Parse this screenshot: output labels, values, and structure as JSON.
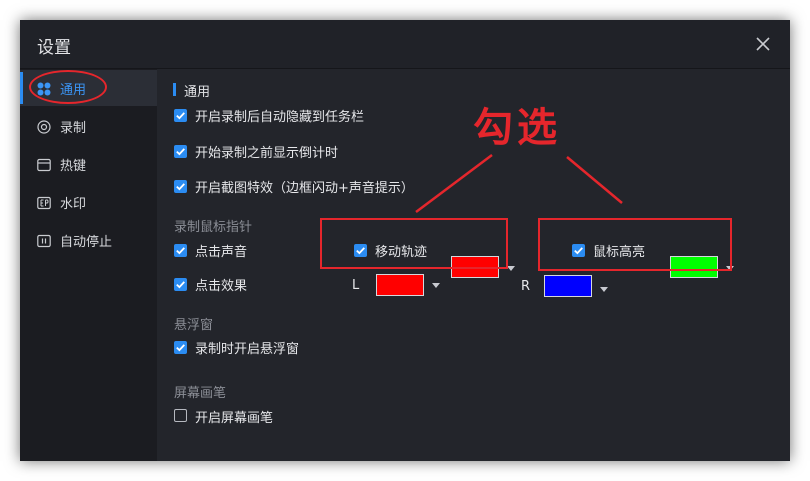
{
  "window": {
    "title": "设置"
  },
  "sidebar": {
    "items": [
      {
        "label": "通用",
        "icon": "grid-icon",
        "active": true
      },
      {
        "label": "录制",
        "icon": "record-icon",
        "active": false
      },
      {
        "label": "热键",
        "icon": "hotkey-icon",
        "active": false
      },
      {
        "label": "水印",
        "icon": "watermark-icon",
        "active": false
      },
      {
        "label": "自动停止",
        "icon": "pause-icon",
        "active": false
      }
    ]
  },
  "general": {
    "section_title": "通用",
    "options": [
      {
        "label": "开启录制后自动隐藏到任务栏",
        "checked": true
      },
      {
        "label": "开始录制之前显示倒计时",
        "checked": true
      },
      {
        "label": "开启截图特效（边框闪动+声音提示）",
        "checked": true
      }
    ]
  },
  "mouse": {
    "group_title": "录制鼠标指针",
    "click_sound": {
      "label": "点击声音",
      "checked": true
    },
    "move_track": {
      "label": "移动轨迹",
      "checked": true,
      "color": "#ff0000"
    },
    "highlight": {
      "label": "鼠标高亮",
      "checked": true,
      "color": "#00ff00"
    },
    "click_effect": {
      "label": "点击效果",
      "checked": true
    },
    "left": {
      "label": "L",
      "color": "#ff0000"
    },
    "right": {
      "label": "R",
      "color": "#0000ff"
    }
  },
  "floating": {
    "group_title": "悬浮窗",
    "option": {
      "label": "录制时开启悬浮窗",
      "checked": true
    }
  },
  "pen": {
    "group_title": "屏幕画笔",
    "option": {
      "label": "开启屏幕画笔",
      "checked": false
    }
  },
  "annotation": {
    "text": "勾选",
    "color": "#e5262c"
  },
  "colors": {
    "accent": "#2b8cf2",
    "background": "#23252b",
    "sidebar": "#1b1c21"
  }
}
